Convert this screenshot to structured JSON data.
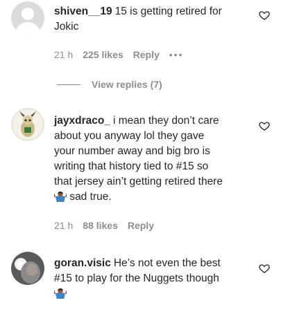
{
  "comments": [
    {
      "username": "shiven__19",
      "text_lines": [
        "15 is getting retired for",
        "Jokic"
      ],
      "time": "21 h",
      "likes": "225 likes",
      "reply": "Reply",
      "more": "•••",
      "view_replies": "View replies (7)"
    },
    {
      "username": "jayxdraco_",
      "text_lines": [
        "i mean they don’t care",
        "about you anyway lol they gave",
        "your number away and big bro is",
        "writing that history tied to #15 so",
        "that jersey ain’t getting retired there"
      ],
      "last_line": "sad true.",
      "time": "21 h",
      "likes": "88 likes",
      "reply": "Reply"
    },
    {
      "username": "goran.visic",
      "text_lines": [
        "He’s not even the best",
        "#15 to play for the Nuggets though"
      ],
      "time": "",
      "likes": "",
      "reply": ""
    }
  ],
  "icons": {
    "heart": "heart-outline-icon",
    "shrug_emoji": "person-shrugging-emoji"
  }
}
